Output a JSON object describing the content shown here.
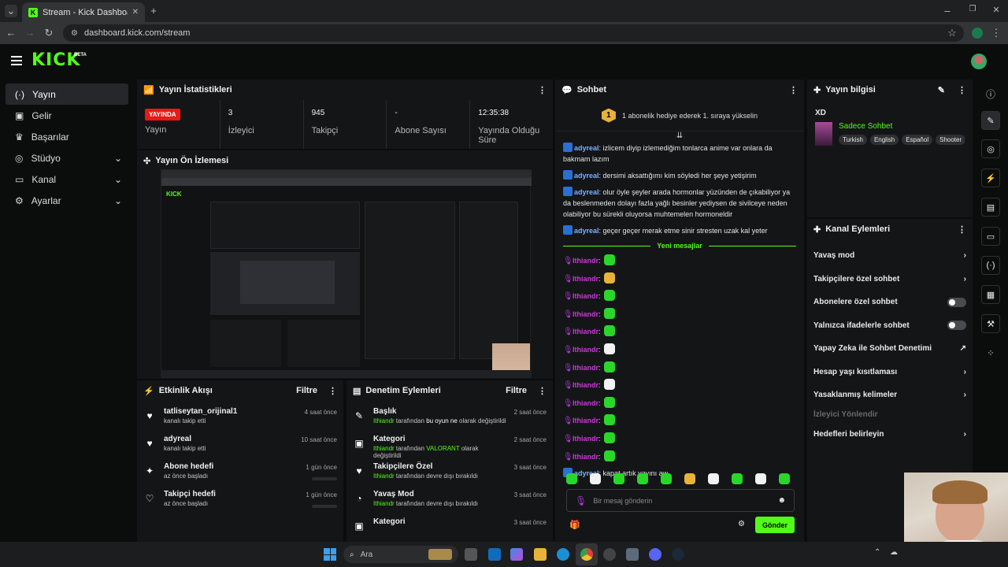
{
  "browser": {
    "tab_title": "Stream - Kick Dashboard",
    "url": "dashboard.kick.com/stream"
  },
  "app": {
    "logo": "KICK",
    "beta": "BETA"
  },
  "nav": [
    {
      "label": "Yayın",
      "icon": "broadcast-icon"
    },
    {
      "label": "Gelir",
      "icon": "wallet-icon"
    },
    {
      "label": "Başarılar",
      "icon": "trophy-icon"
    },
    {
      "label": "Stüdyo",
      "icon": "studio-icon"
    },
    {
      "label": "Kanal",
      "icon": "channel-icon"
    },
    {
      "label": "Ayarlar",
      "icon": "gear-icon"
    }
  ],
  "stats": {
    "title": "Yayın İstatistikleri",
    "live": "YAYINDA",
    "items": [
      {
        "value": "",
        "label": "Yayın"
      },
      {
        "value": "3",
        "label": "İzleyici"
      },
      {
        "value": "945",
        "label": "Takipçi"
      },
      {
        "value": "-",
        "label": "Abone Sayısı"
      },
      {
        "value": "12:35:38",
        "label": "Yayında Olduğu Süre"
      }
    ]
  },
  "preview": {
    "title": "Yayın Ön İzlemesi"
  },
  "activity": {
    "title": "Etkinlik Akışı",
    "filter": "Filtre",
    "items": [
      {
        "title": "tatliseytan_orijinal1",
        "sub": "kanalı takip etti",
        "time": "4 saat önce"
      },
      {
        "title": "adyreal",
        "sub": "kanalı takip etti",
        "time": "10 saat önce"
      },
      {
        "title": "Abone hedefi",
        "sub": "az önce başladı",
        "time": "1 gün önce"
      },
      {
        "title": "Takipçi hedefi",
        "sub": "az önce başladı",
        "time": "1 gün önce"
      }
    ]
  },
  "moderation": {
    "title": "Denetim Eylemleri",
    "filter": "Filtre",
    "by": "tarafından",
    "items": [
      {
        "title": "Başlık",
        "user": "Ithiandr",
        "value": "bu oyun ne",
        "suffix": "olarak değiştirildi",
        "time": "2 saat önce"
      },
      {
        "title": "Kategori",
        "user": "Ithiandr",
        "value": "VALORANT",
        "suffix": "olarak değiştirildi",
        "time": "2 saat önce"
      },
      {
        "title": "Takipçilere Özel",
        "user": "Ithiandr",
        "value": "",
        "suffix": "devre dışı bırakıldı",
        "time": "3 saat önce"
      },
      {
        "title": "Yavaş Mod",
        "user": "Ithiandr",
        "value": "",
        "suffix": "devre dışı bırakıldı",
        "time": "3 saat önce"
      },
      {
        "title": "Kategori",
        "user": "",
        "value": "",
        "suffix": "",
        "time": "3 saat önce"
      }
    ]
  },
  "chat": {
    "title": "Sohbet",
    "banner": "1 abonelik hediye ederek 1. sıraya yükselin",
    "banner_rank": "1",
    "new_messages": "Yeni mesajlar",
    "placeholder": "Bir mesaj gönderin",
    "send": "Gönder",
    "messages": [
      {
        "user": "adyreal",
        "text": "izlicem diyip izlemediğim tonlarca anime var onlara da bakmam lazım"
      },
      {
        "user": "adyreal",
        "text": "dersimi aksattığımı kim söyledi her şeye yetişirim"
      },
      {
        "user": "adyreal",
        "text": "olur öyle şeyler arada hormonlar yüzünden de çıkabiliyor ya da beslenmeden dolayı fazla yağlı besinler yediysen de sivilceye neden olabiliyor bu sürekli oluyorsa muhtemelen hormoneldir"
      },
      {
        "user": "adyreal",
        "text": "geçer geçer merak etme sinir stresten uzak kal yeter"
      }
    ],
    "emote_user": "Ithiandr",
    "emote_count": 12,
    "last": {
      "user": "adyreal",
      "text": "kapat artık yayını aw"
    }
  },
  "info": {
    "title": "Yayın bilgisi",
    "stream_title": "XD",
    "category": "Sadece Sohbet",
    "tags": [
      "Turkish",
      "English",
      "Español",
      "Shooter"
    ]
  },
  "actions": {
    "title": "Kanal Eylemleri",
    "items": [
      {
        "label": "Yavaş mod",
        "kind": "chevron"
      },
      {
        "label": "Takipçilere özel sohbet",
        "kind": "chevron"
      },
      {
        "label": "Abonelere özel sohbet",
        "kind": "toggle"
      },
      {
        "label": "Yalnızca ifadelerle sohbet",
        "kind": "toggle"
      },
      {
        "label": "Yapay Zeka ile Sohbet Denetimi",
        "kind": "external"
      },
      {
        "label": "Hesap yaşı kısıtlaması",
        "kind": "chevron"
      },
      {
        "label": "Yasaklanmış kelimeler",
        "kind": "chevron"
      },
      {
        "label": "İzleyici Yönlendir",
        "kind": "disabled"
      },
      {
        "label": "Hedefleri belirleyin",
        "kind": "chevron"
      }
    ]
  },
  "taskbar": {
    "search": "Ara"
  },
  "colors": {
    "accent": "#53fc18",
    "live": "#e91916",
    "bg": "#0b0d0c",
    "panel": "#141517"
  }
}
